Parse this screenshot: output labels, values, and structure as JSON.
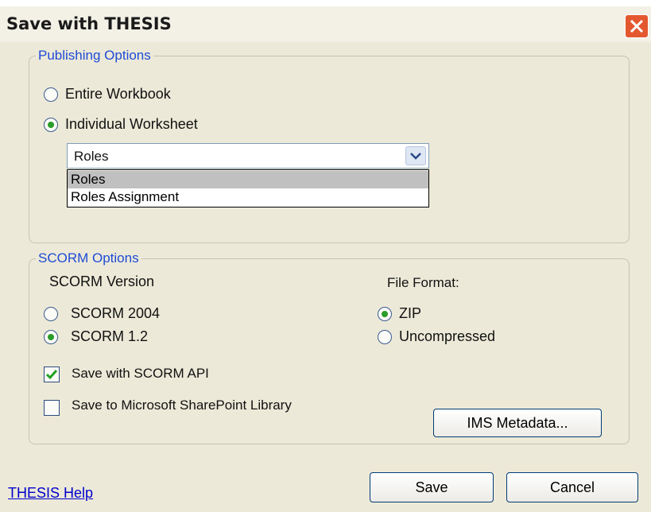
{
  "window": {
    "title": "Save with THESIS"
  },
  "publishing": {
    "legend": "Publishing Options",
    "entire_workbook": "Entire Workbook",
    "individual_worksheet": "Individual Worksheet",
    "worksheet_select_value": "Roles",
    "worksheet_options": [
      "Roles",
      "Roles Assignment"
    ],
    "selected": "Individual Worksheet"
  },
  "scorm": {
    "legend": "SCORM Options",
    "version_label": "SCORM Version",
    "v2004": "SCORM 2004",
    "v12": "SCORM 1.2",
    "selected_version": "SCORM 1.2",
    "format_label": "File Format:",
    "zip": "ZIP",
    "uncompressed": "Uncompressed",
    "selected_format": "ZIP",
    "save_api": "Save with SCORM API",
    "save_api_checked": true,
    "sharepoint": "Save to Microsoft SharePoint Library",
    "sharepoint_checked": false,
    "ims_button": "IMS Metadata..."
  },
  "footer": {
    "help_link": "THESIS Help",
    "save_button": "Save",
    "cancel_button": "Cancel"
  },
  "colors": {
    "legend": "#1f4bd6",
    "close": "#e4582f",
    "radio_dot": "#2a9c2a",
    "link": "#0000cc"
  }
}
